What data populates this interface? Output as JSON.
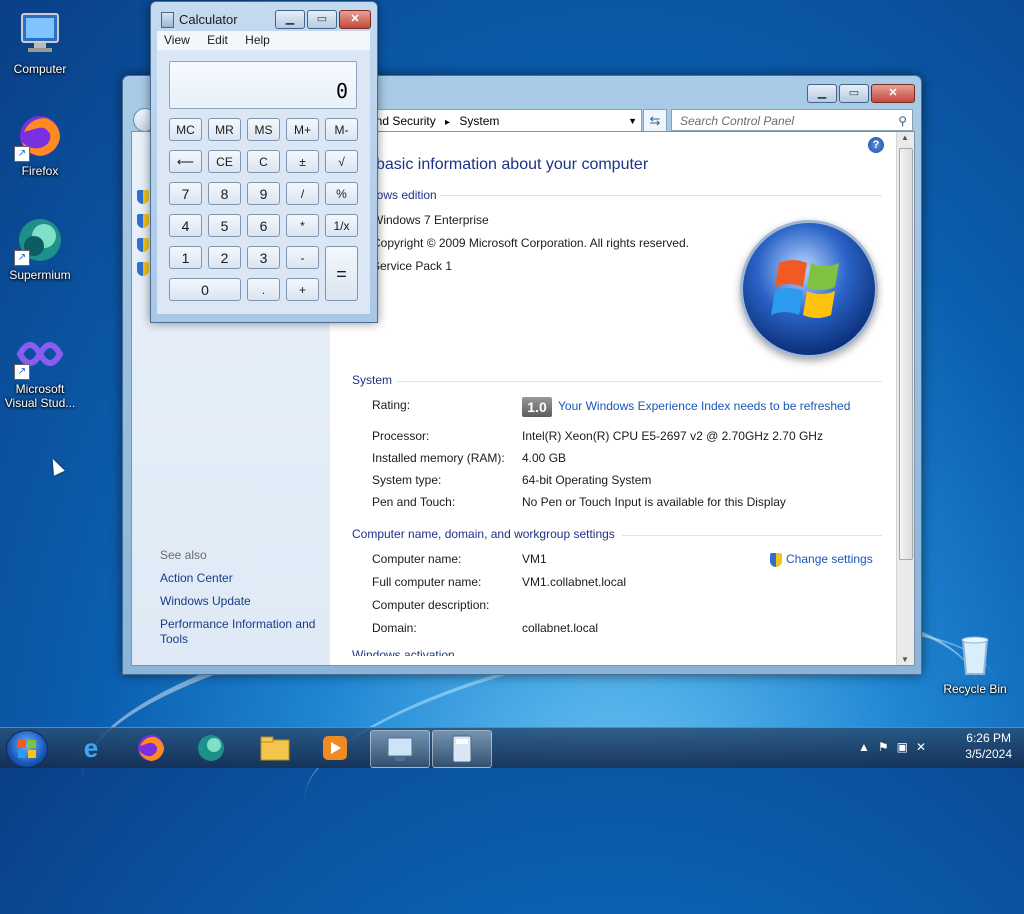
{
  "desktop": {
    "icons": [
      {
        "label": "Computer",
        "icon": "computer-icon"
      },
      {
        "label": "Firefox",
        "icon": "firefox-icon"
      },
      {
        "label": "Supermium",
        "icon": "supermium-icon"
      },
      {
        "label": "Microsoft Visual Stud...",
        "icon": "visual-studio-icon"
      },
      {
        "label": "Recycle Bin",
        "icon": "recycle-bin-icon"
      }
    ]
  },
  "control_panel": {
    "address": {
      "crumb1": "and Security",
      "sep": "▸",
      "crumb2": "System"
    },
    "search_placeholder": "Search Control Panel",
    "heading": "w basic information about your computer",
    "edition": {
      "section": "dows edition",
      "name": "Windows 7 Enterprise",
      "copyright": "Copyright © 2009 Microsoft Corporation.  All rights reserved.",
      "service_pack": "Service Pack 1"
    },
    "system": {
      "section": "System",
      "rating_label": "Rating:",
      "rating_value": "1.0",
      "rating_link": "Your Windows Experience Index needs to be refreshed",
      "processor_label": "Processor:",
      "processor_value": "Intel(R) Xeon(R) CPU E5-2697 v2 @ 2.70GHz   2.70 GHz",
      "memory_label": "Installed memory (RAM):",
      "memory_value": "4.00 GB",
      "type_label": "System type:",
      "type_value": "64-bit Operating System",
      "pen_label": "Pen and Touch:",
      "pen_value": "No Pen or Touch Input is available for this Display"
    },
    "computer_name": {
      "section": "Computer name, domain, and workgroup settings",
      "name_label": "Computer name:",
      "name_value": "VM1",
      "full_label": "Full computer name:",
      "full_value": "VM1.collabnet.local",
      "desc_label": "Computer description:",
      "domain_label": "Domain:",
      "domain_value": "collabnet.local",
      "change_settings": "Change settings"
    },
    "cutoff_section": "Windows activation",
    "sidebar": {
      "see_also": "See also",
      "links": [
        "Action Center",
        "Windows Update",
        "Performance Information and Tools"
      ]
    }
  },
  "calculator": {
    "title": "Calculator",
    "menu": [
      "View",
      "Edit",
      "Help"
    ],
    "display": "0",
    "buttons": {
      "mc": "MC",
      "mr": "MR",
      "ms": "MS",
      "mplus": "M+",
      "mminus": "M-",
      "back": "⟵",
      "ce": "CE",
      "c": "C",
      "plusminus": "±",
      "sqrt": "√",
      "n7": "7",
      "n8": "8",
      "n9": "9",
      "div": "/",
      "pct": "%",
      "n4": "4",
      "n5": "5",
      "n6": "6",
      "mul": "*",
      "recip": "1/x",
      "n1": "1",
      "n2": "2",
      "n3": "3",
      "sub": "-",
      "eq": "=",
      "n0": "0",
      "dot": ".",
      "add": "+"
    }
  },
  "taskbar": {
    "clock_time": "6:26 PM",
    "clock_date": "3/5/2024"
  }
}
